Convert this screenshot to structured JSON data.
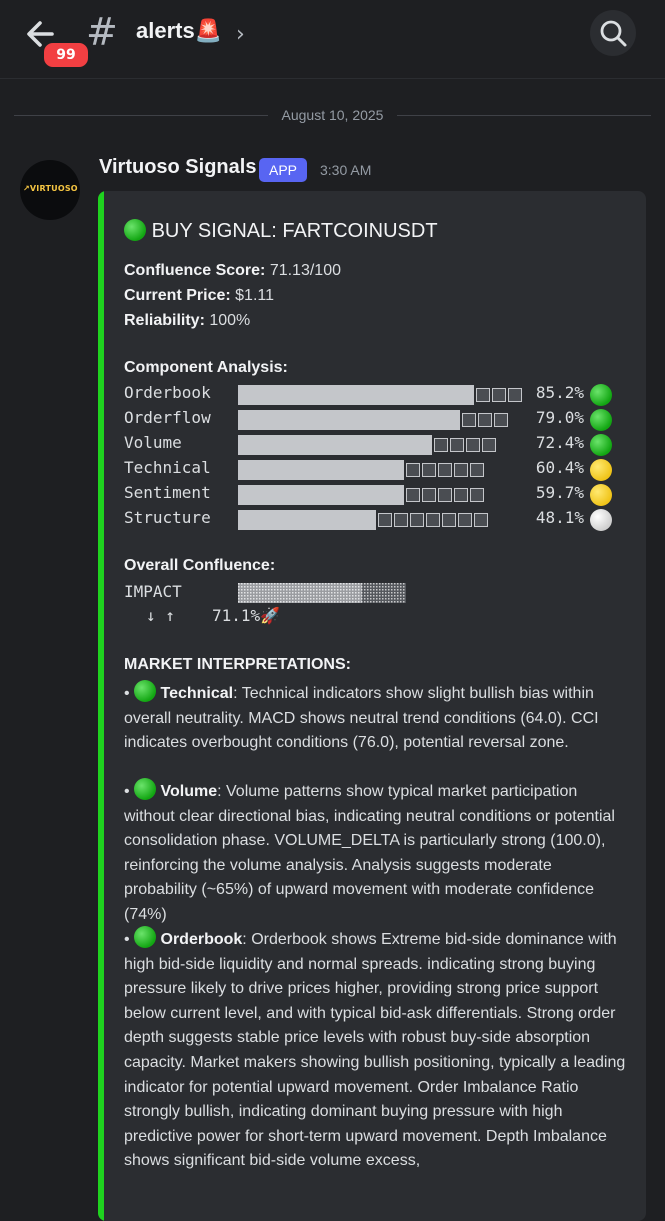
{
  "header": {
    "back_badge": "99",
    "channel_name": "alerts🚨"
  },
  "divider": {
    "date": "August 10, 2025"
  },
  "message": {
    "author": "Virtuoso Signals",
    "tag": "APP",
    "time": "3:30 AM",
    "avatar_text": "↗VIRTUOSO",
    "embed": {
      "accent_color": "#1fd21f",
      "title": "BUY SIGNAL: FARTCOINUSDT",
      "fields": [
        {
          "label": "Confluence Score:",
          "value": "71.13/100"
        },
        {
          "label": "Current Price:",
          "value": "$1.11"
        },
        {
          "label": "Reliability:",
          "value": "100%"
        }
      ],
      "component_heading": "Component Analysis:",
      "components": [
        {
          "name": "Orderbook",
          "score": 85.2,
          "pct": "85.2%",
          "status": "green"
        },
        {
          "name": "Orderflow",
          "score": 79.0,
          "pct": "79.0%",
          "status": "green"
        },
        {
          "name": "Volume",
          "score": 72.4,
          "pct": "72.4%",
          "status": "green"
        },
        {
          "name": "Technical",
          "score": 60.4,
          "pct": "60.4%",
          "status": "yellow"
        },
        {
          "name": "Sentiment",
          "score": 59.7,
          "pct": "59.7%",
          "status": "yellow"
        },
        {
          "name": "Structure",
          "score": 48.1,
          "pct": "48.1%",
          "status": "white"
        }
      ],
      "overall_heading": "Overall Confluence:",
      "impact_label": "IMPACT",
      "impact_arrows": "↓ ↑",
      "impact_value": 71.1,
      "impact_pct": "71.1%🚀",
      "interp_heading": "MARKET INTERPRETATIONS:",
      "interpretations": [
        {
          "title": "Technical",
          "text": ": Technical indicators show slight bullish bias within overall neutrality. MACD shows neutral trend conditions (64.0). CCI indicates overbought conditions (76.0), potential reversal zone."
        },
        {
          "title": "Volume",
          "text": ": Volume patterns show typical market participation without clear directional bias, indicating neutral conditions or potential consolidation phase. VOLUME_DELTA is particularly strong (100.0), reinforcing the volume analysis. Analysis suggests moderate probability (~65%) of upward movement with moderate confidence (74%)"
        },
        {
          "title": "Orderbook",
          "text": ": Orderbook shows Extreme bid-side dominance with high bid-side liquidity and normal spreads. indicating strong buying pressure likely to drive prices higher, providing strong price support below current level, and with typical bid-ask differentials. Strong order depth suggests stable price levels with robust buy-side absorption capacity. Market makers showing bullish positioning, typically a leading indicator for potential upward movement. Order Imbalance Ratio strongly bullish, indicating dominant buying pressure with high predictive power for short-term upward movement. Depth Imbalance shows significant bid-side volume excess,"
        }
      ]
    }
  }
}
